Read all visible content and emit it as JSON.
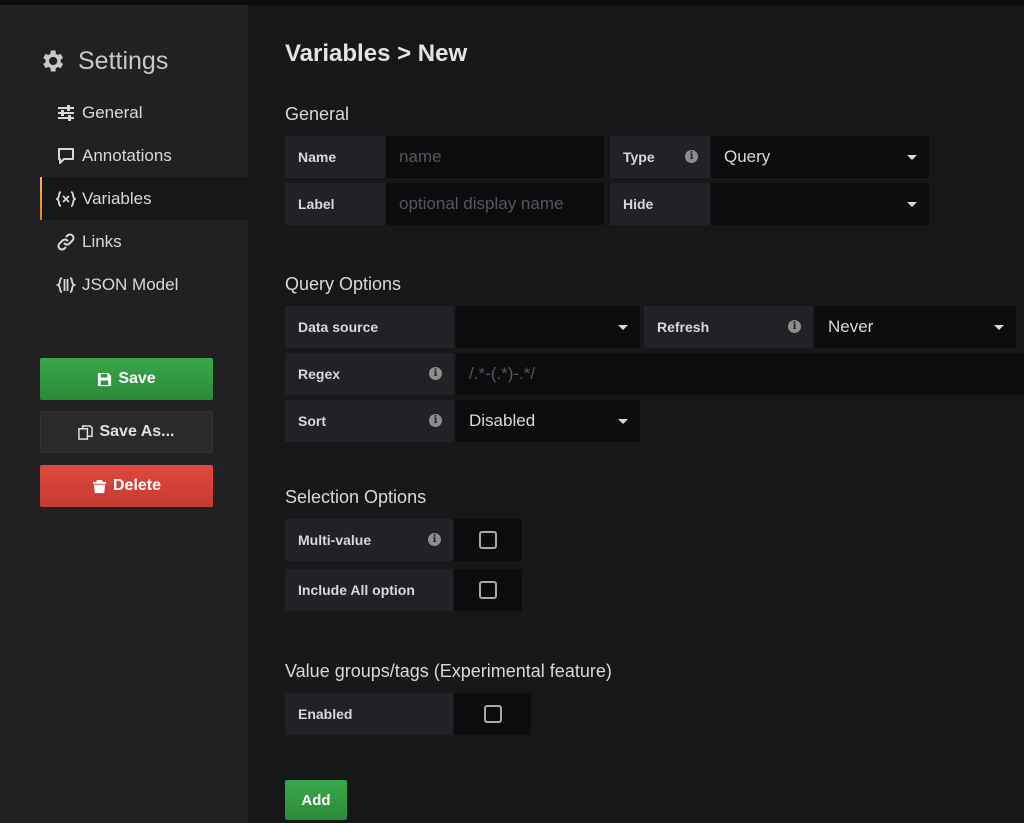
{
  "sidebar": {
    "title": "Settings",
    "items": [
      {
        "label": "General",
        "icon": "sliders-icon"
      },
      {
        "label": "Annotations",
        "icon": "comment-icon"
      },
      {
        "label": "Variables",
        "icon": "variable-icon"
      },
      {
        "label": "Links",
        "icon": "link-icon"
      },
      {
        "label": "JSON Model",
        "icon": "json-icon"
      }
    ],
    "save_label": "Save",
    "save_as_label": "Save As...",
    "delete_label": "Delete"
  },
  "page": {
    "title": "Variables > New"
  },
  "general": {
    "title": "General",
    "name_label": "Name",
    "name_placeholder": "name",
    "type_label": "Type",
    "type_value": "Query",
    "label_label": "Label",
    "label_placeholder": "optional display name",
    "hide_label": "Hide",
    "hide_value": ""
  },
  "query_options": {
    "title": "Query Options",
    "datasource_label": "Data source",
    "datasource_value": "",
    "refresh_label": "Refresh",
    "refresh_value": "Never",
    "regex_label": "Regex",
    "regex_placeholder": "/.*-(.*)-.*/",
    "sort_label": "Sort",
    "sort_value": "Disabled"
  },
  "selection_options": {
    "title": "Selection Options",
    "multi_label": "Multi-value",
    "include_all_label": "Include All option"
  },
  "value_groups": {
    "title": "Value groups/tags (Experimental feature)",
    "enabled_label": "Enabled"
  },
  "add_label": "Add",
  "colors": {
    "accent": "#eb7b18",
    "success": "#2a8a38",
    "danger": "#c43b33"
  }
}
